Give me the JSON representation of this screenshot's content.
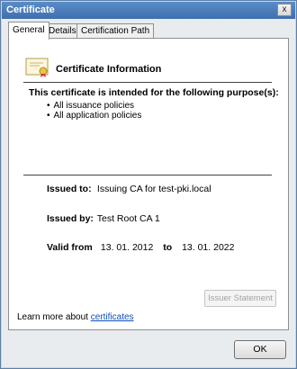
{
  "window": {
    "title": "Certificate",
    "close_glyph": "x"
  },
  "tabs": [
    {
      "label": "General",
      "active": true
    },
    {
      "label": "Details",
      "active": false
    },
    {
      "label": "Certification Path",
      "active": false
    }
  ],
  "general": {
    "icon": "certificate-icon",
    "info_title": "Certificate Information",
    "purpose_heading": "This certificate is intended for the following purpose(s):",
    "purposes": [
      "All issuance policies",
      "All application policies"
    ],
    "issued_to_label": "Issued to:",
    "issued_to_value": "Issuing CA for test-pki.local",
    "issued_by_label": "Issued by:",
    "issued_by_value": "Test Root CA 1",
    "valid_from_label": "Valid from",
    "valid_from_value": "13. 01. 2012",
    "valid_to_label": "to",
    "valid_to_value": "13. 01. 2022",
    "issuer_statement_label": "Issuer Statement",
    "learn_more_text": "Learn more about",
    "learn_more_link": "certificates"
  },
  "footer": {
    "ok_label": "OK"
  },
  "colors": {
    "title_bar": "#4a7dbb",
    "link": "#0b4fb5",
    "disabled_text": "#a3a3a3"
  }
}
